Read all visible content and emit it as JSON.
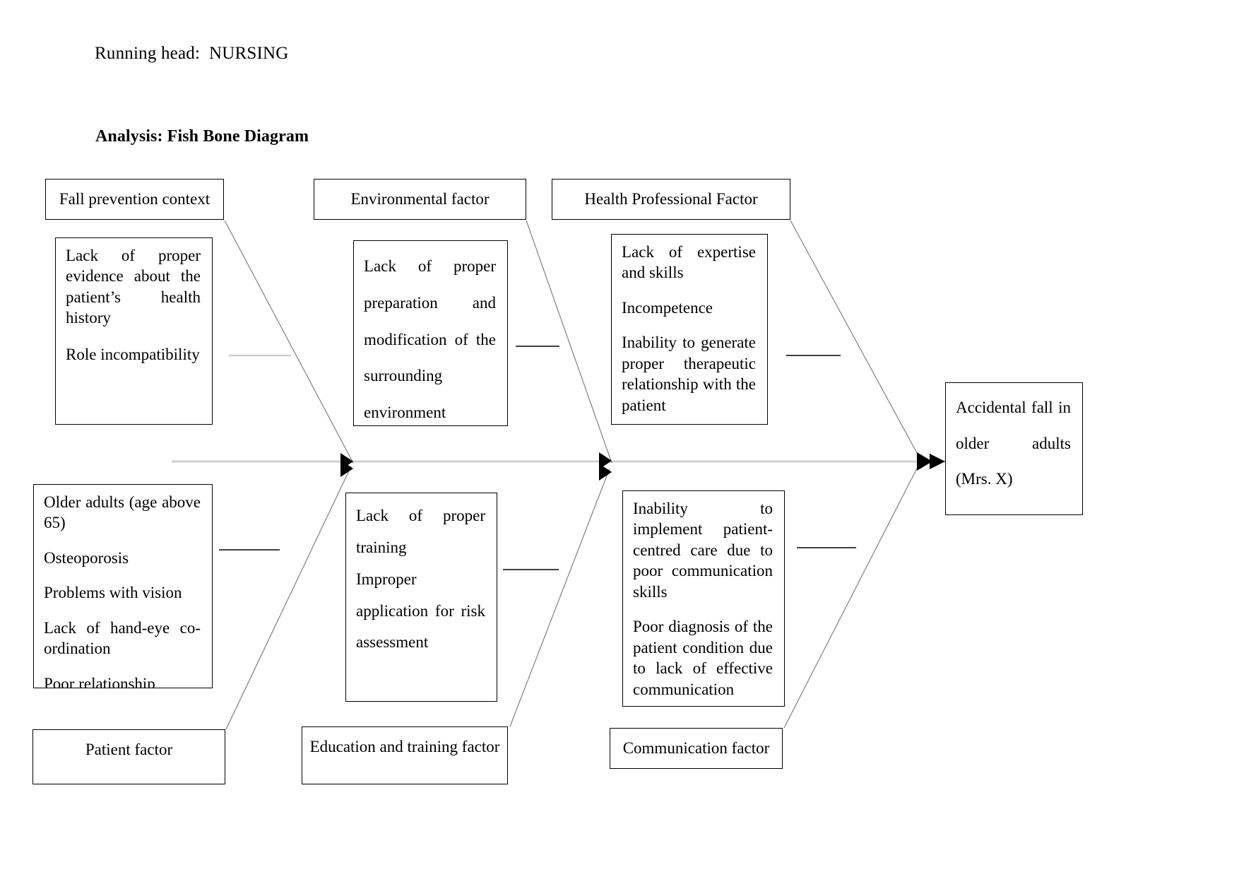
{
  "document": {
    "running_head": "Running head:  NURSING",
    "title": "Analysis: Fish Bone Diagram"
  },
  "diagram": {
    "type": "fishbone-ishikawa",
    "effect": {
      "label": "Accidental fall in older adults (Mrs. X)"
    },
    "top_categories": [
      {
        "name": "fall-prevention-context",
        "label": "Fall prevention context",
        "causes": [
          "Lack of proper evidence about the patient’s health history",
          "Role incompatibility"
        ]
      },
      {
        "name": "environmental-factor",
        "label": "Environmental factor",
        "causes": [
          "Lack of proper preparation and modification of the surrounding environment"
        ]
      },
      {
        "name": "health-professional-factor",
        "label": "Health Professional Factor",
        "causes": [
          "Lack of expertise and skills",
          "Incompetence",
          "Inability to generate proper therapeutic relationship with the patient"
        ]
      }
    ],
    "bottom_categories": [
      {
        "name": "patient-factor",
        "label": "Patient factor",
        "causes": [
          "Older adults (age above 65)",
          "Osteoporosis",
          "Problems with vision",
          "Lack of hand-eye co-ordination",
          "Poor relationship"
        ]
      },
      {
        "name": "education-and-training-factor",
        "label": "Education and training factor",
        "causes": [
          "Lack of proper training",
          "Improper application for risk assessment"
        ]
      },
      {
        "name": "communication-factor",
        "label": "Communication factor",
        "causes": [
          "Inability to implement patient-centred care due to poor communication skills",
          "Poor diagnosis of the patient condition due to lack of effective communication"
        ]
      }
    ],
    "colors": {
      "spine": "#d0d0d0",
      "rib": "#808080",
      "connector": "#c8c8c8",
      "arrow": "#000000",
      "box_border": "#000000",
      "background": "#ffffff"
    }
  }
}
